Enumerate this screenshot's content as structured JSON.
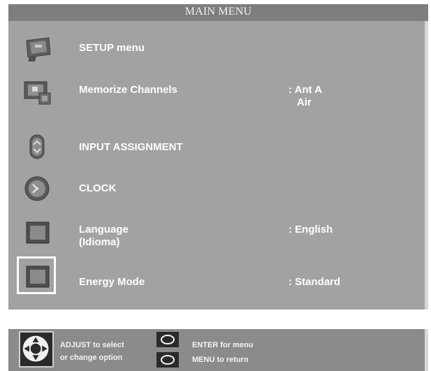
{
  "header": {
    "title": "MAIN MENU"
  },
  "menu": {
    "items": [
      {
        "icon": "setup-icon",
        "label": "SETUP menu",
        "value": "",
        "value2": ""
      },
      {
        "icon": "memorize-channels-icon",
        "label": "Memorize Channels",
        "value": ": Ant A",
        "value2": "Air"
      },
      {
        "icon": "input-assignment-icon",
        "label": "INPUT ASSIGNMENT",
        "value": "",
        "value2": ""
      },
      {
        "icon": "clock-icon",
        "label": "CLOCK",
        "value": "",
        "value2": ""
      },
      {
        "icon": "language-icon",
        "label": "Language",
        "label2": "(Idioma)",
        "value": ": English"
      },
      {
        "icon": "energy-mode-icon",
        "label": "Energy Mode",
        "value": ": Standard",
        "selected": true
      }
    ]
  },
  "footer": {
    "adjust_line1": "ADJUST to select",
    "adjust_line2": "or change option",
    "enter_hint": "ENTER for menu",
    "menu_hint": "MENU  to  return"
  },
  "colors": {
    "panel": "#a2a2a2",
    "title_bar": "#7e7e7e",
    "footer": "#8b8b8b",
    "text": "#ffffff"
  }
}
